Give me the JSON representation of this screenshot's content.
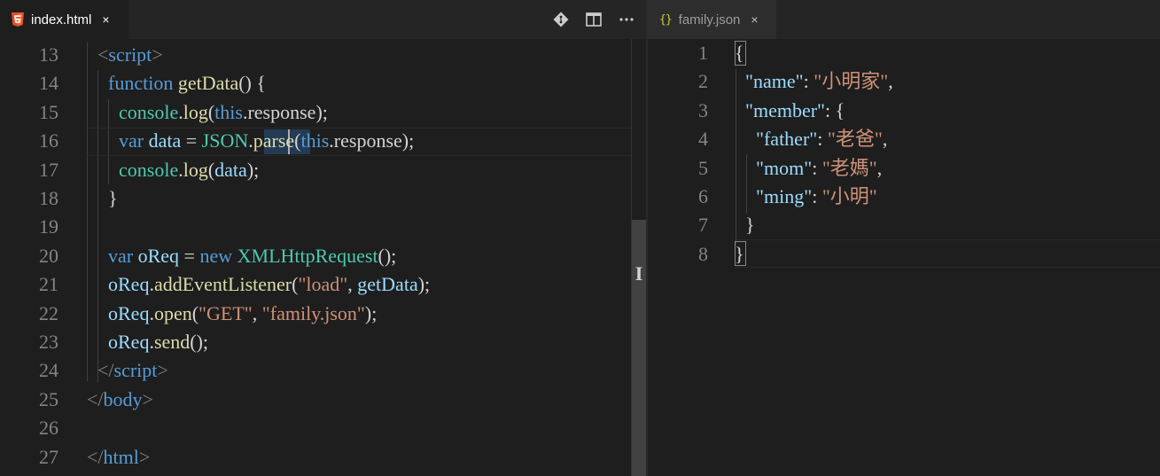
{
  "left_editor": {
    "tab": {
      "label": "index.html",
      "icon": "html5-icon",
      "close": "×"
    },
    "actions": [
      "git-compare-icon",
      "split-editor-icon",
      "more-actions-icon"
    ],
    "lines": [
      {
        "number": "13",
        "tokens": [
          [
            "t-tag",
            "<"
          ],
          [
            "t-tagname",
            "script"
          ],
          [
            "t-tag",
            ">"
          ]
        ]
      },
      {
        "number": "14",
        "tokens": [
          [
            "t-kw",
            "function "
          ],
          [
            "t-fn",
            "getData"
          ],
          [
            "t-plain",
            "() {"
          ]
        ]
      },
      {
        "number": "15",
        "tokens": [
          [
            "t-cls",
            "console"
          ],
          [
            "t-plain",
            "."
          ],
          [
            "t-fn",
            "log"
          ],
          [
            "t-plain",
            "("
          ],
          [
            "t-kw",
            "this"
          ],
          [
            "t-plain",
            "."
          ],
          [
            "t-plain",
            "response"
          ],
          [
            "t-plain",
            ");"
          ]
        ]
      },
      {
        "number": "16",
        "tokens": [
          [
            "t-kw",
            "var "
          ],
          [
            "t-var",
            "data"
          ],
          [
            "t-plain",
            " = "
          ],
          [
            "t-cls",
            "JSON"
          ],
          [
            "t-plain",
            "."
          ],
          [
            "t-fn",
            "parse"
          ],
          [
            "t-plain",
            "("
          ],
          [
            "t-kw",
            "this"
          ],
          [
            "t-plain",
            "."
          ],
          [
            "t-plain",
            "response"
          ],
          [
            "t-plain",
            ");"
          ]
        ]
      },
      {
        "number": "17",
        "tokens": [
          [
            "t-cls",
            "console"
          ],
          [
            "t-plain",
            "."
          ],
          [
            "t-fn",
            "log"
          ],
          [
            "t-plain",
            "("
          ],
          [
            "t-var",
            "data"
          ],
          [
            "t-plain",
            ");"
          ]
        ]
      },
      {
        "number": "18",
        "tokens": [
          [
            "t-plain",
            "}"
          ]
        ]
      },
      {
        "number": "19",
        "tokens": []
      },
      {
        "number": "20",
        "tokens": [
          [
            "t-kw",
            "var "
          ],
          [
            "t-var",
            "oReq"
          ],
          [
            "t-plain",
            " = "
          ],
          [
            "t-kw",
            "new "
          ],
          [
            "t-cls",
            "XMLHttpRequest"
          ],
          [
            "t-plain",
            "();"
          ]
        ]
      },
      {
        "number": "21",
        "tokens": [
          [
            "t-var",
            "oReq"
          ],
          [
            "t-plain",
            "."
          ],
          [
            "t-fn",
            "addEventListener"
          ],
          [
            "t-plain",
            "("
          ],
          [
            "t-str",
            "\"load\""
          ],
          [
            "t-plain",
            ", "
          ],
          [
            "t-var",
            "getData"
          ],
          [
            "t-plain",
            ");"
          ]
        ]
      },
      {
        "number": "22",
        "tokens": [
          [
            "t-var",
            "oReq"
          ],
          [
            "t-plain",
            "."
          ],
          [
            "t-fn",
            "open"
          ],
          [
            "t-plain",
            "("
          ],
          [
            "t-str",
            "\"GET\""
          ],
          [
            "t-plain",
            ", "
          ],
          [
            "t-str",
            "\"family.json\""
          ],
          [
            "t-plain",
            ");"
          ]
        ]
      },
      {
        "number": "23",
        "tokens": [
          [
            "t-var",
            "oReq"
          ],
          [
            "t-plain",
            "."
          ],
          [
            "t-fn",
            "send"
          ],
          [
            "t-plain",
            "();"
          ]
        ]
      },
      {
        "number": "24",
        "tokens": [
          [
            "t-tag",
            "</"
          ],
          [
            "t-tagname",
            "script"
          ],
          [
            "t-tag",
            ">"
          ]
        ]
      },
      {
        "number": "25",
        "tokens": [
          [
            "t-tag",
            "</"
          ],
          [
            "t-tagname",
            "body"
          ],
          [
            "t-tag",
            ">"
          ]
        ]
      },
      {
        "number": "26",
        "tokens": []
      },
      {
        "number": "27",
        "tokens": [
          [
            "t-tag",
            "</"
          ],
          [
            "t-tagname",
            "html"
          ],
          [
            "t-tag",
            ">"
          ]
        ]
      }
    ]
  },
  "right_editor": {
    "tab": {
      "label": "family.json",
      "icon": "json-braces-icon",
      "icon_text": "{}",
      "close": "×"
    },
    "lines": [
      {
        "number": "1",
        "tokens": [
          [
            "t-punc",
            "{"
          ]
        ]
      },
      {
        "number": "2",
        "tokens": [
          [
            "t-key",
            "\"name\""
          ],
          [
            "t-punc",
            ": "
          ],
          [
            "t-str",
            "\"小明家\""
          ],
          [
            "t-punc",
            ","
          ]
        ]
      },
      {
        "number": "3",
        "tokens": [
          [
            "t-key",
            "\"member\""
          ],
          [
            "t-punc",
            ": {"
          ]
        ]
      },
      {
        "number": "4",
        "tokens": [
          [
            "t-key",
            "\"father\""
          ],
          [
            "t-punc",
            ": "
          ],
          [
            "t-str",
            "\"老爸\""
          ],
          [
            "t-punc",
            ","
          ]
        ]
      },
      {
        "number": "5",
        "tokens": [
          [
            "t-key",
            "\"mom\""
          ],
          [
            "t-punc",
            ": "
          ],
          [
            "t-str",
            "\"老媽\""
          ],
          [
            "t-punc",
            ","
          ]
        ]
      },
      {
        "number": "6",
        "tokens": [
          [
            "t-key",
            "\"ming\""
          ],
          [
            "t-punc",
            ": "
          ],
          [
            "t-str",
            "\"小明\""
          ]
        ]
      },
      {
        "number": "7",
        "tokens": [
          [
            "t-punc",
            "}"
          ]
        ]
      },
      {
        "number": "8",
        "tokens": [
          [
            "t-punc",
            "}"
          ]
        ]
      }
    ]
  },
  "colors": {
    "background": "#1e1e1e",
    "tab_bar": "#252526",
    "keyword": "#569cd6",
    "function": "#dcdcaa",
    "string": "#ce9178",
    "class": "#4ec9b0",
    "variable": "#9cdcfe"
  }
}
